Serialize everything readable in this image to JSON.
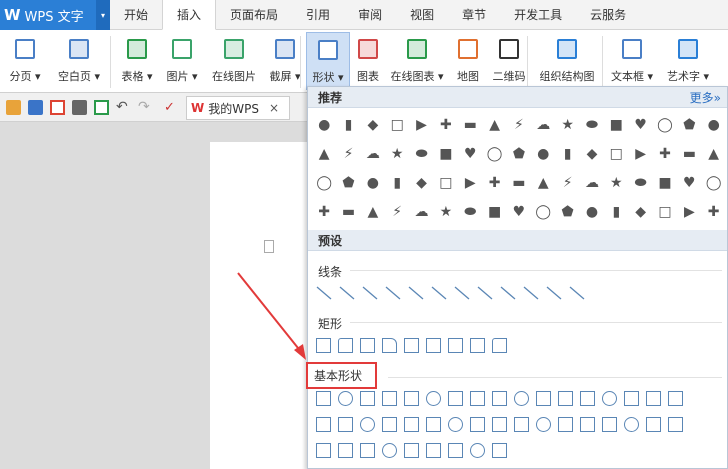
{
  "app": {
    "logo": "W",
    "name": "WPS 文字",
    "dropdown": "▾"
  },
  "tabs": [
    "开始",
    "插入",
    "页面布局",
    "引用",
    "审阅",
    "视图",
    "章节",
    "开发工具",
    "云服务"
  ],
  "active_tab": "插入",
  "ribbon": [
    {
      "label": "分页",
      "dd": true
    },
    {
      "label": "空白页",
      "dd": true
    },
    {
      "label": "表格",
      "dd": true
    },
    {
      "label": "图片",
      "dd": true
    },
    {
      "label": "在线图片"
    },
    {
      "label": "截屏",
      "dd": true
    },
    {
      "label": "形状",
      "dd": true,
      "selected": true
    },
    {
      "label": "图表"
    },
    {
      "label": "在线图表",
      "dd": true
    },
    {
      "label": "地图"
    },
    {
      "label": "二维码"
    },
    {
      "label": "组织结构图"
    },
    {
      "label": "文本框",
      "dd": true
    },
    {
      "label": "艺术字",
      "dd": true
    }
  ],
  "doc_tab": {
    "label": "我的WPS",
    "close": "×"
  },
  "panel": {
    "recommended": "推荐",
    "more": "更多»",
    "preset": "预设",
    "lines": "线条",
    "rect": "矩形",
    "basic": "基本形状"
  },
  "colors": {
    "accent": "#2b7fd6",
    "callout": "#e23a3a",
    "shape_stroke": "#5a86b5"
  }
}
